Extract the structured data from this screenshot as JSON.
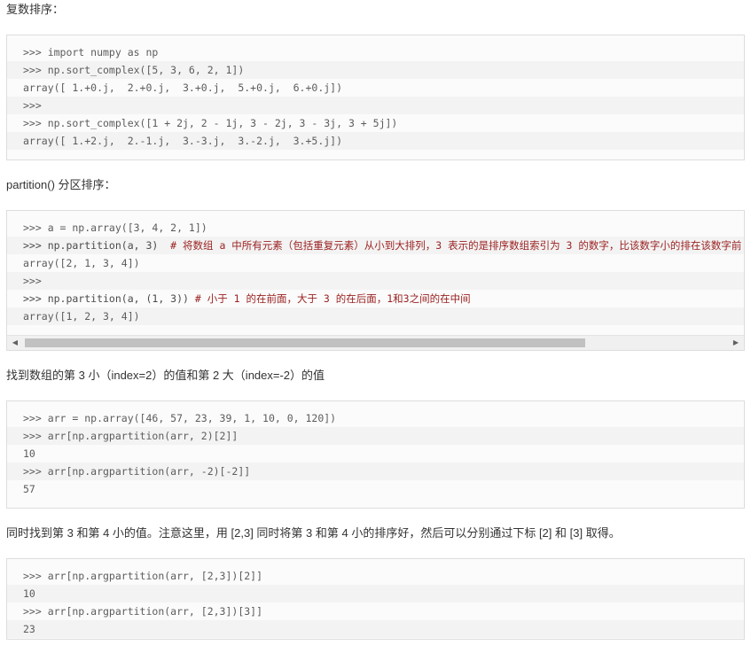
{
  "sections": [
    {
      "heading": "复数排序：",
      "lines": [
        ">>> import numpy as np",
        ">>> np.sort_complex([5, 3, 6, 2, 1])",
        "array([ 1.+0.j,  2.+0.j,  3.+0.j,  5.+0.j,  6.+0.j])",
        ">>>",
        ">>> np.sort_complex([1 + 2j, 2 - 1j, 3 - 2j, 3 - 3j, 3 + 5j])",
        "array([ 1.+2.j,  2.-1.j,  3.-3.j,  3.-2.j,  3.+5.j])"
      ]
    },
    {
      "heading": "partition() 分区排序：",
      "lines": [
        ">>> a = np.array([3, 4, 2, 1])",
        ">>> np.partition(a, 3)  ",
        "array([2, 1, 3, 4])",
        ">>>",
        ">>> np.partition(a, (1, 3)) ",
        "array([1, 2, 3, 4])"
      ],
      "comments": {
        "line2": "# 将数组 a 中所有元素（包括重复元素）从小到大排列，3 表示的是排序数组索引为 3 的数字，比该数字小的排在该数字前",
        "line5": "# 小于 1 的在前面，大于 3 的在后面，1和3之间的在中间"
      },
      "scrollbar": {
        "left_arrow": "◀",
        "right_arrow": "▶"
      }
    },
    {
      "heading": "找到数组的第 3 小（index=2）的值和第 2 大（index=-2）的值",
      "lines": [
        ">>> arr = np.array([46, 57, 23, 39, 1, 10, 0, 120])",
        ">>> arr[np.argpartition(arr, 2)[2]]",
        "10",
        ">>> arr[np.argpartition(arr, -2)[-2]]",
        "57"
      ]
    },
    {
      "heading": "同时找到第 3 和第 4 小的值。注意这里，用 [2,3] 同时将第 3 和第 4 小的排序好，然后可以分别通过下标 [2] 和 [3] 取得。",
      "lines": [
        ">>> arr[np.argpartition(arr, [2,3])[2]]",
        "10",
        ">>> arr[np.argpartition(arr, [2,3])[3]]",
        "23"
      ]
    }
  ]
}
